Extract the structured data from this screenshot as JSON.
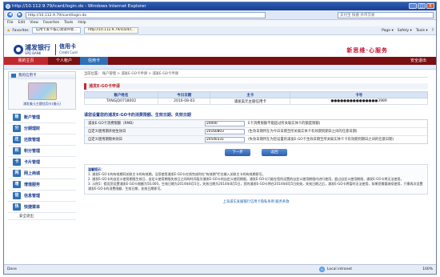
{
  "window": {
    "title": "http://10.112.9.79/icard/login.do - Windows Internet Explorer",
    "controls": [
      "_",
      "□",
      "X"
    ]
  },
  "address": {
    "url": "http://10.112.9.79/icard/login.do",
    "search_placeholder": "支付宝 快捷 外币交易"
  },
  "menubar": [
    "File",
    "Edit",
    "View",
    "Favorites",
    "Tools",
    "Help"
  ],
  "favbar": {
    "favorites": "Favorites",
    "tabs": [
      "信用卡发卡核心测试环境...",
      "http://10.112.9.79/icard/l..."
    ],
    "tools": [
      "Page ▾",
      "Safety ▾",
      "Tools ▾",
      "?"
    ]
  },
  "bank": {
    "logo_cn": "浦发银行",
    "logo_en": "SPD BANK",
    "card_cn": "信用卡",
    "card_en": "Credit Card",
    "slogan": "新思维·心服务",
    "head_links": ""
  },
  "mainnav": {
    "home": "我的主页",
    "items": [
      "个人帐户",
      "信用卡"
    ],
    "exit": "安全退出"
  },
  "sidebar": {
    "card_title": "我的信用卡",
    "card_name": "浦发美元主题信用卡(美元)",
    "items": [
      {
        "icon": "账",
        "label": "账户管理"
      },
      {
        "icon": "分",
        "label": "分期理财"
      },
      {
        "icon": "还",
        "label": "还款管理"
      },
      {
        "icon": "积",
        "label": "积分管理"
      },
      {
        "icon": "卡",
        "label": "卡片管理"
      },
      {
        "icon": "网",
        "label": "网上商城"
      },
      {
        "icon": "增",
        "label": "增值服务"
      },
      {
        "icon": "信",
        "label": "信息管理"
      },
      {
        "icon": "快",
        "label": "快捷菜单"
      }
    ],
    "logout": "安全退出"
  },
  "breadcrumb": "当前位置： 账户管理 > 浦发E-GO卡申请 > 浦发E-GO卡申请",
  "section1": {
    "title": "浦发E-GO卡申请",
    "headers": [
      "账户姓名",
      "今日日期",
      "主卡",
      "卡号"
    ],
    "row": [
      "TANGJQ0718002",
      "2016-08-03",
      "浦发美元主题信用卡",
      "●●●●●●●●●●●●●●●3989"
    ]
  },
  "section2": {
    "title": "请您设置您的浦发E-GO卡的消费限额、生效日期、失效日期",
    "rows": [
      {
        "label": "浦发E-GO卡消费限额（RMB）",
        "value": "20000",
        "hint": "E卡消费限额不能超过所关联实体卡的额度限额)"
      },
      {
        "label": "自定义使用期开始生效日",
        "value": "20160803",
        "hint": "(生效日期所在为今日日期至所关联实体卡有效期到期日之间的任意日期)"
      },
      {
        "label": "自定义使用期限失效日",
        "value": "20540331",
        "hint": "(失效日期所在为您设置的浦发E-GO卡生效日期至所关联实体卡卡有效期到期日之间的任意日期)"
      }
    ],
    "buttons": [
      "下一步",
      "返回"
    ]
  },
  "notes": {
    "title": "温馨提示：",
    "lines": [
      "1. 浦发E-GO卡的有效期同关联主卡的有效期。当您使用浦发E-GO卡在线完成时在\"有效期\"栏位输入关联主卡的有效期即可。",
      "2. 浦发E-GO卡的自定义使用期限生效日，自定义使用期限失效日之间的时间段为浦发E-GO卡的自定义使用期限，浦发E-GO卡只能在您所设置的自定义使用期限内进行使用，超过自定义使用期限，浦发E-GO卡将无法使用。",
      "3. 示例1：假设您设置浦发E-GO卡限额为50,000，生效日期为2014年8月5日，失效日期为2014年8月5日，您的浦发E-GO卡将在2014年8月5日失效，失效日期之后，浦发E-GO卡将暂时无法使用，如果您需要继续使用，只需再次设置浦发E-GO卡的消费限额、生效日期、失效日期即可。"
    ]
  },
  "footer_link": "上海浦东发展银行信用卡隐私条例 服务条款",
  "status": {
    "left": "Done",
    "zone": "Local intranet",
    "zoom": "100%"
  }
}
